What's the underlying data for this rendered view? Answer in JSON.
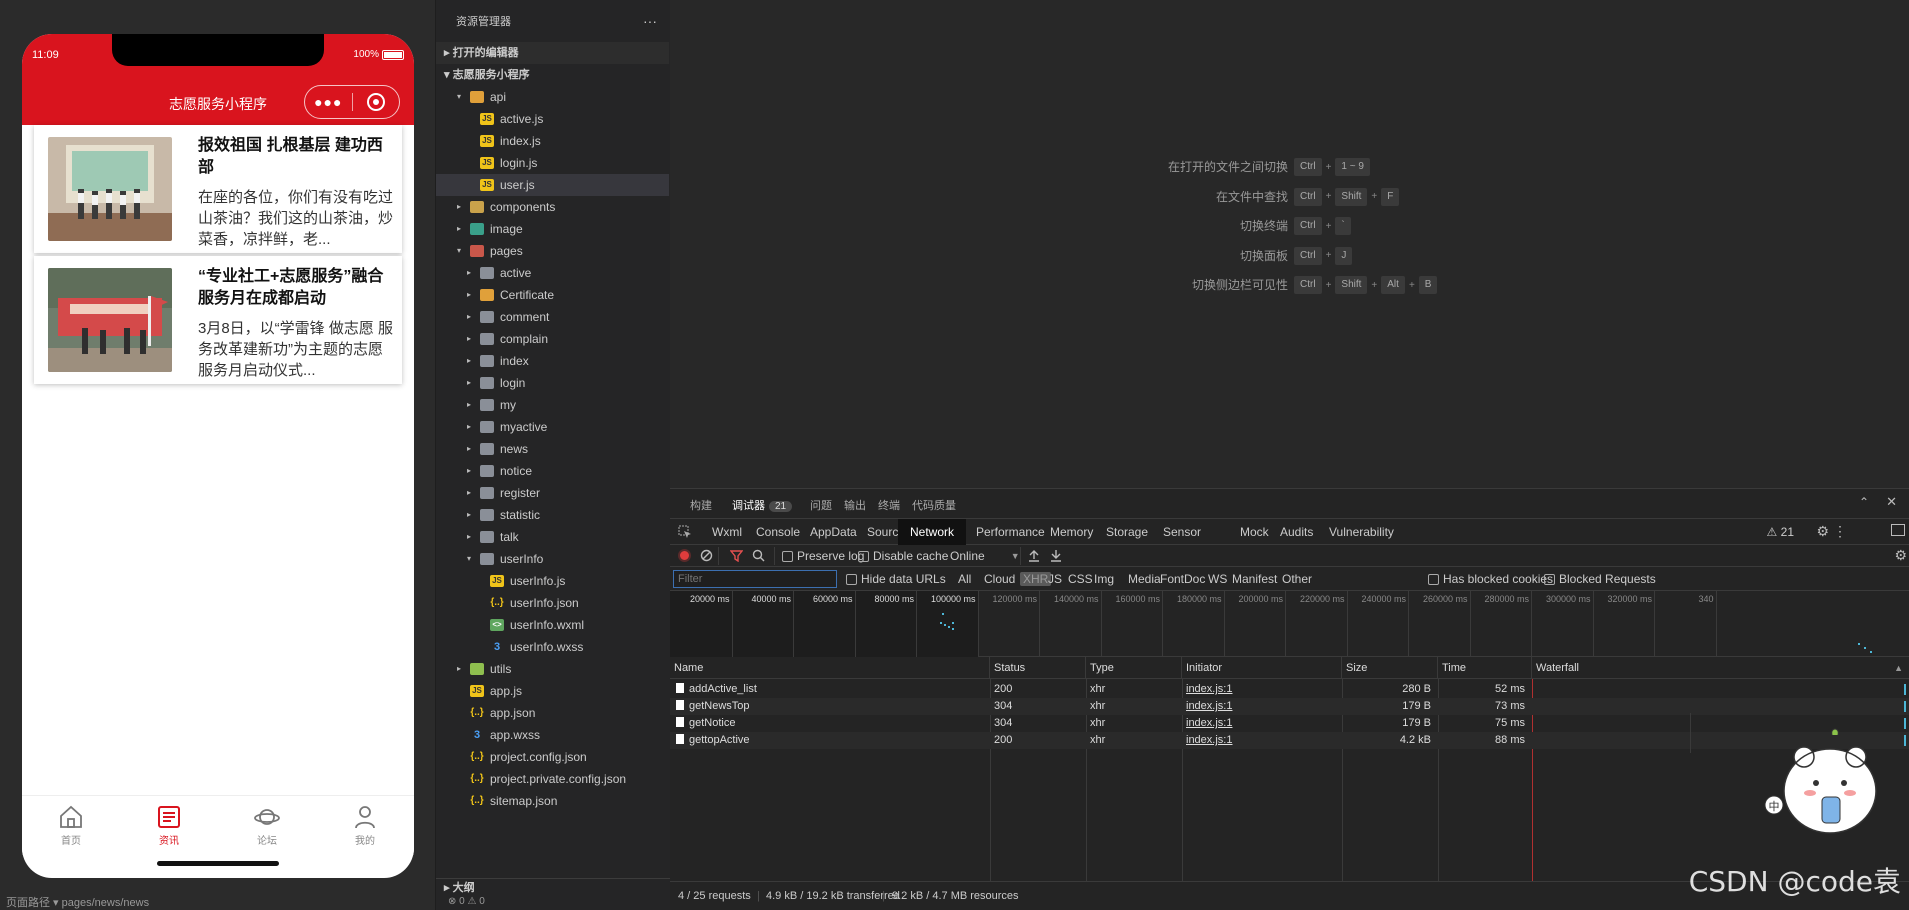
{
  "simulator": {
    "time": "11:09",
    "battery": "100%",
    "nav_title": "志愿服务小程序",
    "cards": [
      {
        "title": "报效祖国 扎根基层 建功西部",
        "desc": "在座的各位，你们有没有吃过山茶油？我们这的山茶油，炒菜香，凉拌鲜，老..."
      },
      {
        "title": "“专业社工+志愿服务”融合服务月在成都启动",
        "desc": "3月8日，以“学雷锋 做志愿 服务改革建新功”为主题的志愿服务月启动仪式..."
      }
    ],
    "tabbar": [
      {
        "label": "首页",
        "icon": "home-icon"
      },
      {
        "label": "资讯",
        "icon": "news-icon"
      },
      {
        "label": "论坛",
        "icon": "planet-icon"
      },
      {
        "label": "我的",
        "icon": "user-icon"
      }
    ],
    "footer": "页面路径 ▾  pages/news/news"
  },
  "explorer": {
    "title": "资源管理器",
    "more": "···",
    "open_editors": "打开的编辑器",
    "project": "志愿服务小程序",
    "tree": [
      {
        "label": "api",
        "type": "folder-open",
        "icon": "fold-orange",
        "indent": 1
      },
      {
        "label": "active.js",
        "type": "file",
        "icon": "js",
        "indent": 2
      },
      {
        "label": "index.js",
        "type": "file",
        "icon": "js",
        "indent": 2
      },
      {
        "label": "login.js",
        "type": "file",
        "icon": "js",
        "indent": 2
      },
      {
        "label": "user.js",
        "type": "file",
        "icon": "js",
        "indent": 2,
        "selected": true
      },
      {
        "label": "components",
        "type": "folder",
        "icon": "fold",
        "indent": 1
      },
      {
        "label": "image",
        "type": "folder",
        "icon": "fold-teal",
        "indent": 1
      },
      {
        "label": "pages",
        "type": "folder-open",
        "icon": "fold-red",
        "indent": 1
      },
      {
        "label": "active",
        "type": "folder",
        "icon": "fold-gray",
        "indent": 2
      },
      {
        "label": "Certificate",
        "type": "folder",
        "icon": "fold-orange",
        "indent": 2
      },
      {
        "label": "comment",
        "type": "folder",
        "icon": "fold-gray",
        "indent": 2
      },
      {
        "label": "complain",
        "type": "folder",
        "icon": "fold-gray",
        "indent": 2
      },
      {
        "label": "index",
        "type": "folder",
        "icon": "fold-gray",
        "indent": 2
      },
      {
        "label": "login",
        "type": "folder",
        "icon": "fold-gray",
        "indent": 2
      },
      {
        "label": "my",
        "type": "folder",
        "icon": "fold-gray",
        "indent": 2
      },
      {
        "label": "myactive",
        "type": "folder",
        "icon": "fold-gray",
        "indent": 2
      },
      {
        "label": "news",
        "type": "folder",
        "icon": "fold-gray",
        "indent": 2
      },
      {
        "label": "notice",
        "type": "folder",
        "icon": "fold-gray",
        "indent": 2
      },
      {
        "label": "register",
        "type": "folder",
        "icon": "fold-gray",
        "indent": 2
      },
      {
        "label": "statistic",
        "type": "folder",
        "icon": "fold-gray",
        "indent": 2
      },
      {
        "label": "talk",
        "type": "folder",
        "icon": "fold-gray",
        "indent": 2
      },
      {
        "label": "userInfo",
        "type": "folder-open",
        "icon": "fold-gray",
        "indent": 2
      },
      {
        "label": "userInfo.js",
        "type": "file",
        "icon": "js",
        "indent": 3
      },
      {
        "label": "userInfo.json",
        "type": "file",
        "icon": "json",
        "indent": 3
      },
      {
        "label": "userInfo.wxml",
        "type": "file",
        "icon": "wxml",
        "indent": 3
      },
      {
        "label": "userInfo.wxss",
        "type": "file",
        "icon": "wxss",
        "indent": 3
      },
      {
        "label": "utils",
        "type": "folder",
        "icon": "fold-green",
        "indent": 1
      },
      {
        "label": "app.js",
        "type": "file",
        "icon": "js",
        "indent": 1
      },
      {
        "label": "app.json",
        "type": "file",
        "icon": "json",
        "indent": 1
      },
      {
        "label": "app.wxss",
        "type": "file",
        "icon": "wxss",
        "indent": 1
      },
      {
        "label": "project.config.json",
        "type": "file",
        "icon": "json",
        "indent": 1
      },
      {
        "label": "project.private.config.json",
        "type": "file",
        "icon": "json",
        "indent": 1
      },
      {
        "label": "sitemap.json",
        "type": "file",
        "icon": "json",
        "indent": 1
      }
    ],
    "outline": "大纲",
    "status": "⊗ 0 ⚠ 0"
  },
  "editor": {
    "hints": [
      {
        "label": "在打开的文件之间切换",
        "keys": [
          "Ctrl",
          "1 ~ 9"
        ]
      },
      {
        "label": "在文件中查找",
        "keys": [
          "Ctrl",
          "Shift",
          "F"
        ]
      },
      {
        "label": "切换终端",
        "keys": [
          "Ctrl",
          "`"
        ]
      },
      {
        "label": "切换面板",
        "keys": [
          "Ctrl",
          "J"
        ]
      },
      {
        "label": "切换侧边栏可见性",
        "keys": [
          "Ctrl",
          "Shift",
          "Alt",
          "B"
        ]
      }
    ]
  },
  "devtools": {
    "panel_tabs": [
      "构建",
      "调试器",
      "问题",
      "输出",
      "终端",
      "代码质量"
    ],
    "debugger_count": "21",
    "tool_tabs": [
      "Wxml",
      "Console",
      "AppData",
      "Sources",
      "Network",
      "Performance",
      "Memory",
      "Storage",
      "Sensor",
      "Mock",
      "Audits",
      "Vulnerability"
    ],
    "warn_count": "⚠ 21",
    "toolbar": {
      "preserve_log": "Preserve log",
      "disable_cache": "Disable cache",
      "throttle": "Online"
    },
    "filter": {
      "placeholder": "Filter",
      "hide_data_urls": "Hide data URLs",
      "types": [
        "All",
        "Cloud",
        "XHR",
        "JS",
        "CSS",
        "Img",
        "Media",
        "Font",
        "Doc",
        "WS",
        "Manifest",
        "Other"
      ],
      "blocked_cookies": "Has blocked cookies",
      "blocked_requests": "Blocked Requests"
    },
    "overview_ticks": [
      "20000 ms",
      "40000 ms",
      "60000 ms",
      "80000 ms",
      "100000 ms",
      "120000 ms",
      "140000 ms",
      "160000 ms",
      "180000 ms",
      "200000 ms",
      "220000 ms",
      "240000 ms",
      "260000 ms",
      "280000 ms",
      "300000 ms",
      "320000 ms",
      "340"
    ],
    "columns": [
      "Name",
      "Status",
      "Type",
      "Initiator",
      "Size",
      "Time",
      "Waterfall"
    ],
    "rows": [
      {
        "name": "addActive_list",
        "status": "200",
        "type": "xhr",
        "initiator": "index.js:1",
        "size": "280 B",
        "time": "52 ms"
      },
      {
        "name": "getNewsTop",
        "status": "304",
        "type": "xhr",
        "initiator": "index.js:1",
        "size": "179 B",
        "time": "73 ms"
      },
      {
        "name": "getNotice",
        "status": "304",
        "type": "xhr",
        "initiator": "index.js:1",
        "size": "179 B",
        "time": "75 ms"
      },
      {
        "name": "gettopActive",
        "status": "200",
        "type": "xhr",
        "initiator": "index.js:1",
        "size": "4.2 kB",
        "time": "88 ms"
      }
    ],
    "status_bar": {
      "requests": "4 / 25 requests",
      "transferred": "4.9 kB / 19.2 kB transferred",
      "resources": "9.2 kB / 4.7 MB resources"
    }
  },
  "watermark": "CSDN @code袁",
  "colors": {
    "brand_red": "#d9141e",
    "record_red": "#e03c3c",
    "accent_blue": "#3c6fb0"
  }
}
